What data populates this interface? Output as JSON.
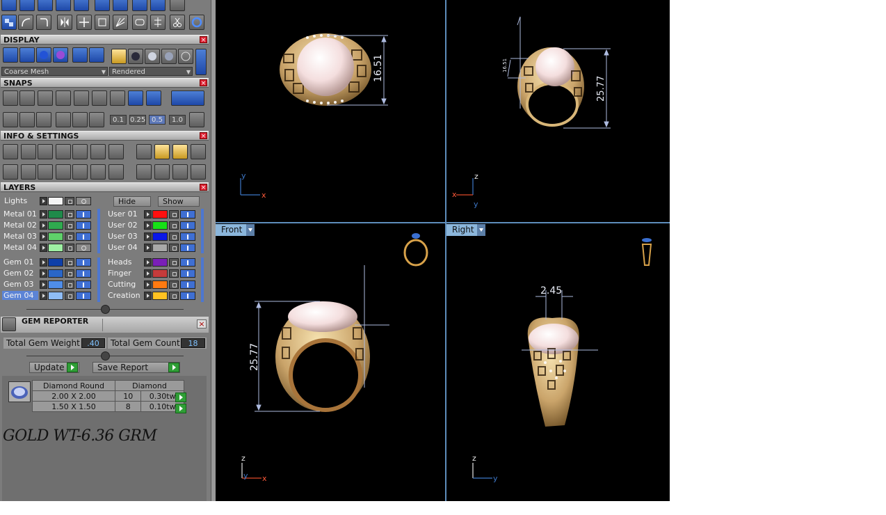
{
  "sections": {
    "display": "DISPLAY",
    "snaps": "SNAPS",
    "info": "INFO & SETTINGS",
    "layers": "LAYERS",
    "gem_reporter": "GEM REPORTER"
  },
  "display": {
    "mesh_select": "Coarse Mesh",
    "render_select": "Rendered"
  },
  "snaps": {
    "values": [
      "0.1",
      "0.25",
      "0.5",
      "1.0"
    ],
    "selected_value": "0.5"
  },
  "layers": {
    "lights_label": "Lights",
    "hide_label": "Hide",
    "show_label": "Show",
    "left_group1": [
      {
        "name": "Metal 01",
        "color": "#1f8a4a"
      },
      {
        "name": "Metal 02",
        "color": "#2faa4f"
      },
      {
        "name": "Metal 03",
        "color": "#5fd06a"
      },
      {
        "name": "Metal 04",
        "color": "#9ef0a3"
      }
    ],
    "left_group2": [
      {
        "name": "Gem 01",
        "color": "#0f3fa8"
      },
      {
        "name": "Gem 02",
        "color": "#2a66c8"
      },
      {
        "name": "Gem 03",
        "color": "#4f8de8"
      },
      {
        "name": "Gem 04",
        "color": "#8fbcf5"
      }
    ],
    "right_group1": [
      {
        "name": "User 01",
        "color": "#ff1010"
      },
      {
        "name": "User 02",
        "color": "#16e016"
      },
      {
        "name": "User 03",
        "color": "#0a18e8"
      },
      {
        "name": "User 04",
        "color": "#a8a8a8"
      }
    ],
    "right_group2": [
      {
        "name": "Heads",
        "color": "#7a1fb8"
      },
      {
        "name": "Finger",
        "color": "#c53b3b"
      },
      {
        "name": "Cutting",
        "color": "#ff7a12"
      },
      {
        "name": "Creation",
        "color": "#ffc222"
      }
    ],
    "selected": "Gem 04"
  },
  "gem_reporter": {
    "total_weight_label": "Total Gem Weight",
    "total_weight": ".40",
    "total_count_label": "Total Gem Count",
    "total_count": "18",
    "update_label": "Update",
    "save_label": "Save Report",
    "table": {
      "header": [
        "Diamond Round",
        "Diamond"
      ],
      "rows": [
        [
          "2.00 X 2.00",
          "10",
          "0.30tw"
        ],
        [
          "1.50 X 1.50",
          "8",
          "0.10tw"
        ]
      ]
    }
  },
  "note": "GOLD WT-6.36 GRM",
  "viewports": {
    "top_left": {
      "dimension": "16.51",
      "axes": [
        "y",
        "x"
      ]
    },
    "top_right": {
      "dimension": "25.77",
      "small_dimension": "16.51",
      "axes": [
        "z",
        "x",
        "y"
      ]
    },
    "bottom_left": {
      "tab": "Front",
      "dimension": "25.77",
      "axes": [
        "z",
        "y",
        "x"
      ]
    },
    "bottom_right": {
      "tab": "Right",
      "dimension": "2.45",
      "axes": [
        "z",
        "y"
      ]
    }
  }
}
